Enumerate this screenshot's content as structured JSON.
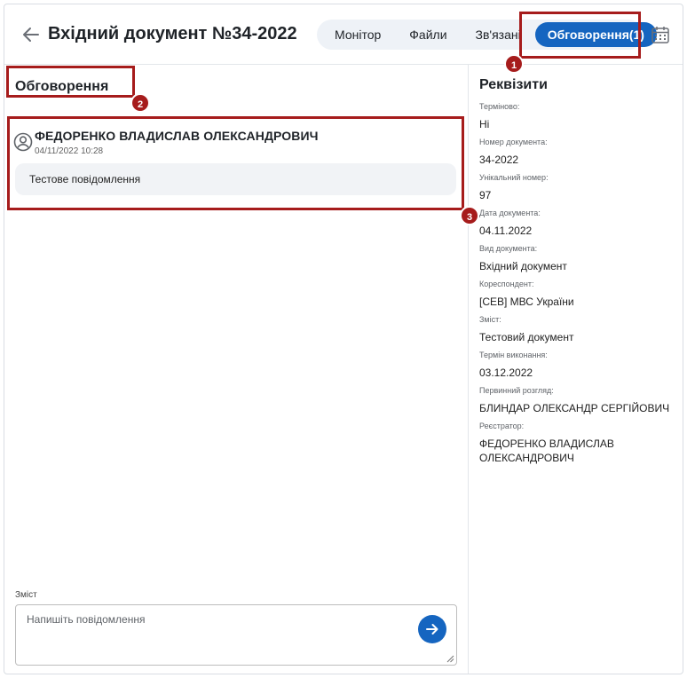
{
  "header": {
    "title": "Вхідний документ №34-2022",
    "tabs": [
      {
        "label": "Монітор"
      },
      {
        "label": "Файли"
      },
      {
        "label": "Зв'язані"
      },
      {
        "label": "Обговорення(1)",
        "active": true
      }
    ]
  },
  "discussion": {
    "title": "Обговорення",
    "comments": [
      {
        "author": "ФЕДОРЕНКО ВЛАДИСЛАВ ОЛЕКСАНДРОВИЧ",
        "time": "04/11/2022 10:28",
        "text": "Тестове повідомлення"
      }
    ],
    "compose": {
      "label": "Зміст",
      "placeholder": "Напишіть повідомлення"
    }
  },
  "requisites": {
    "title": "Реквізити",
    "items": [
      {
        "label": "Терміново:",
        "value": "Ні"
      },
      {
        "label": "Номер документа:",
        "value": "34-2022"
      },
      {
        "label": "Унікальний номер:",
        "value": "97"
      },
      {
        "label": "Дата документа:",
        "value": "04.11.2022"
      },
      {
        "label": "Вид документа:",
        "value": "Вхідний документ"
      },
      {
        "label": "Кореспондент:",
        "value": "[CEB] МВС України"
      },
      {
        "label": "Зміст:",
        "value": "Тестовий документ"
      },
      {
        "label": "Термін виконання:",
        "value": "03.12.2022"
      },
      {
        "label": "Первинний розгляд:",
        "value": "БЛИНДАР ОЛЕКСАНДР СЕРГІЙОВИЧ"
      },
      {
        "label": "Реєстратор:",
        "value": "ФЕДОРЕНКО ВЛАДИСЛАВ ОЛЕКСАНДРОВИЧ"
      }
    ]
  },
  "annotations": [
    "1",
    "2",
    "3"
  ],
  "colors": {
    "accent": "#1565c0",
    "annotation": "#a61c1c",
    "bubble": "#f1f3f6"
  }
}
